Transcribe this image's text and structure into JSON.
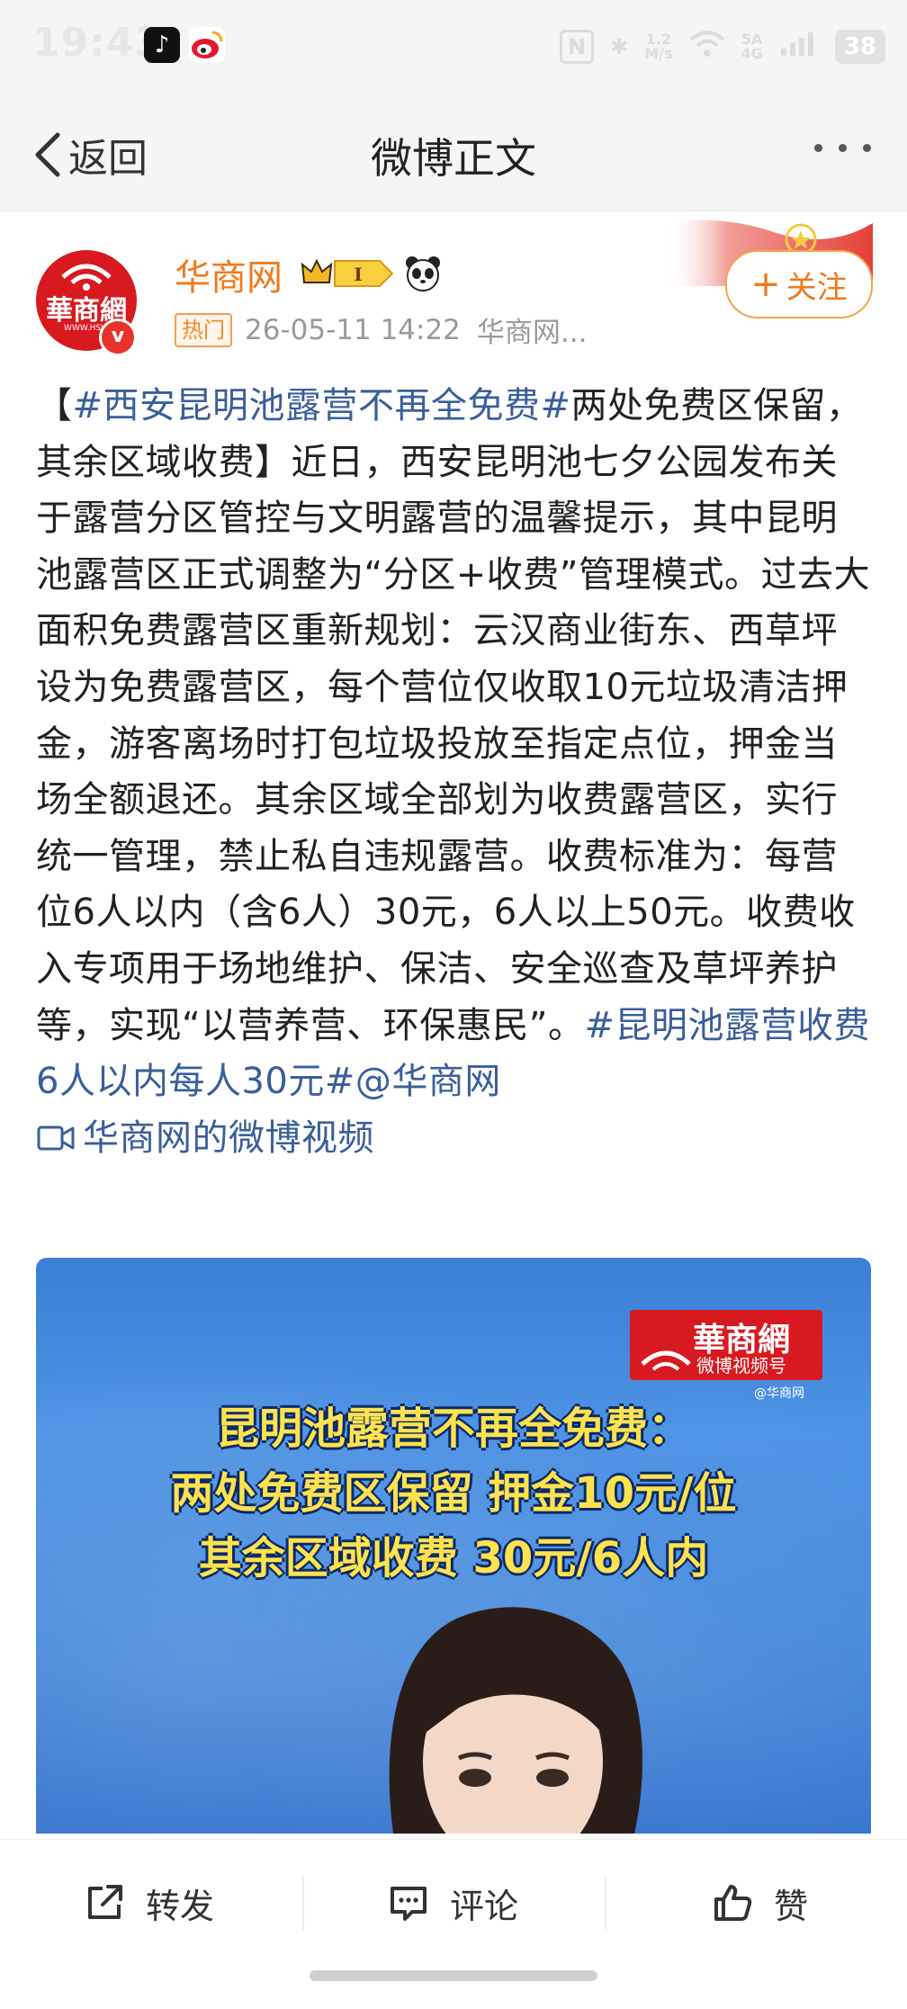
{
  "status_bar": {
    "time": "19:43",
    "network_speed": "1.2\nM/s",
    "signal_label": "5A\n4G",
    "battery": "38"
  },
  "nav": {
    "back_label": "返回",
    "title": "微博正文"
  },
  "author": {
    "avatar_text": "華商網",
    "avatar_site": "WWW.HSW",
    "name": "华商网",
    "vip_level": "I",
    "hot_badge": "热门",
    "time": "26-05-11 14:22",
    "source": "华商网...",
    "follow_label": "关注"
  },
  "post": {
    "seg1": "【",
    "tag1": "#西安昆明池露营不再全免费#",
    "seg2": "两处免费区保留，其余区域收费】近日，西安昆明池七夕公园发布关于露营分区管控与文明露营的温馨提示，其中昆明池露营区正式调整为“分区+收费”管理模式。过去大面积免费露营区重新规划：云汉商业街东、西草坪设为免费露营区，每个营位仅收取10元垃圾清洁押金，游客离场时打包垃圾投放至指定点位，押金当场全额退还。其余区域全部划为收费露营区，实行统一管理，禁止私自违规露营。收费标准为：每营位6人以内（含6人）30元，6人以上50元。收费收入专项用于场地维护、保洁、安全巡查及草坪养护等，实现“以营养营、环保惠民”。",
    "tag2": "#昆明池露营收费6人以内每人30元#",
    "mention": "@华商网",
    "video_link": "华商网的微博视频"
  },
  "video": {
    "logo_text": "華商網",
    "logo_sub": "微博视频号",
    "watermark": "@华商网",
    "headline_1": "昆明池露营不再全免费：",
    "headline_2": "两处免费区保留 押金10元/位",
    "headline_3": "其余区域收费 30元/6人内"
  },
  "actions": {
    "repost": "转发",
    "comment": "评论",
    "like": "赞"
  },
  "colors": {
    "accent_orange": "#f07a1c",
    "link_blue": "#3a5f9a",
    "brand_red": "#d81920",
    "video_blue": "#3f86db",
    "headline_yellow": "#ffe24d"
  }
}
